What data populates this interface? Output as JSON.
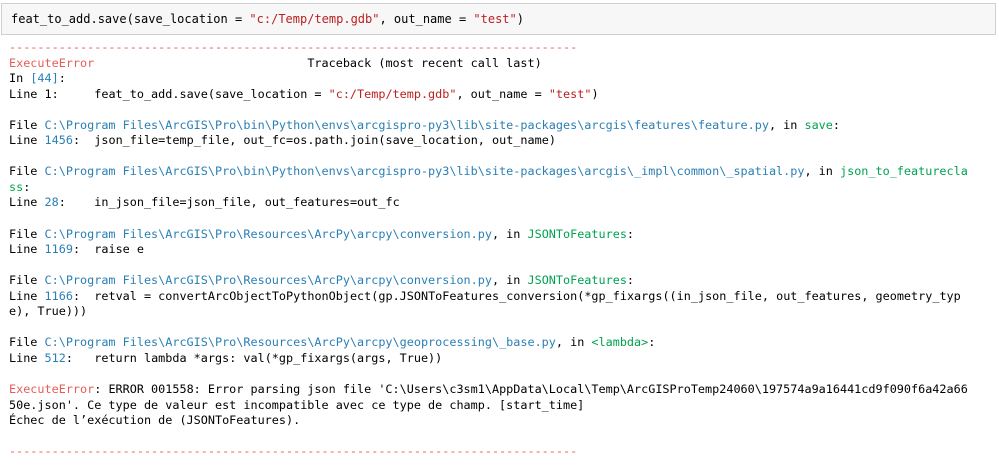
{
  "input_cell": {
    "code_prefix": "feat_to_add.save(save_location = ",
    "arg1": "\"c:/Temp/temp.gdb\"",
    "mid": ", out_name = ",
    "arg2": "\"test\"",
    "suffix": ")"
  },
  "traceback": {
    "rule": "--------------------------------------------------------------------------------",
    "error_type": "ExecuteError",
    "header_gap": "                              ",
    "header_title": "Traceback (most recent call last)",
    "in_label": "In ",
    "in_ref": "[44]",
    "in_colon": ":",
    "first_line_label": "Line 1:",
    "first_line_pad": "     ",
    "first_code_prefix": "feat_to_add.save(save_location = ",
    "first_arg1": "\"c:/Temp/temp.gdb\"",
    "first_mid": ", out_name = ",
    "first_arg2": "\"test\"",
    "first_suffix": ")",
    "frames": [
      {
        "file_label": "File ",
        "path": "C:\\Program Files\\ArcGIS\\Pro\\bin\\Python\\envs\\arcgispro-py3\\lib\\site-packages\\arcgis\\features\\feature.py",
        "in_text": ", in ",
        "func": "save",
        "func_cont": "",
        "tail": ":",
        "line_label": "Line ",
        "line_no": "1456",
        "line_colon": ":",
        "code_pad": "  ",
        "code_lines": [
          "json_file=temp_file, out_fc=os.path.join(save_location, out_name)"
        ],
        "code_cont": ""
      },
      {
        "file_label": "File ",
        "path": "C:\\Program Files\\ArcGIS\\Pro\\bin\\Python\\envs\\arcgispro-py3\\lib\\site-packages\\arcgis\\_impl\\common\\_spatial.py",
        "in_text": ", in ",
        "func": "json_to_featurecla",
        "func_cont": "ss",
        "tail": ":",
        "line_label": "Line ",
        "line_no": "28",
        "line_colon": ":",
        "code_pad": "    ",
        "code_lines": [
          "in_json_file=json_file, out_features=out_fc"
        ],
        "code_cont": ""
      },
      {
        "file_label": "File ",
        "path": "C:\\Program Files\\ArcGIS\\Pro\\Resources\\ArcPy\\arcpy\\conversion.py",
        "in_text": ", in ",
        "func": "JSONToFeatures",
        "func_cont": "",
        "tail": ":",
        "line_label": "Line ",
        "line_no": "1169",
        "line_colon": ":",
        "code_pad": "  ",
        "code_lines": [
          "raise e"
        ],
        "code_cont": ""
      },
      {
        "file_label": "File ",
        "path": "C:\\Program Files\\ArcGIS\\Pro\\Resources\\ArcPy\\arcpy\\conversion.py",
        "in_text": ", in ",
        "func": "JSONToFeatures",
        "func_cont": "",
        "tail": ":",
        "line_label": "Line ",
        "line_no": "1166",
        "line_colon": ":",
        "code_pad": "  ",
        "code_lines": [
          "retval = convertArcObjectToPythonObject(gp.JSONToFeatures_conversion(*gp_fixargs((in_json_file, out_features, geometry_typ"
        ],
        "code_cont": "e), True)))"
      },
      {
        "file_label": "File ",
        "path": "C:\\Program Files\\ArcGIS\\Pro\\Resources\\ArcPy\\arcpy\\geoprocessing\\_base.py",
        "in_text": ", in ",
        "func": "<lambda>",
        "func_cont": "",
        "tail": ":",
        "line_label": "Line ",
        "line_no": "512",
        "line_colon": ":",
        "code_pad": "   ",
        "code_lines": [
          "return lambda *args: val(*gp_fixargs(args, True))"
        ],
        "code_cont": ""
      }
    ],
    "final_error_type": "ExecuteError",
    "final_message_1": ": ERROR 001558: Error parsing json file 'C:\\Users\\c3sm1\\AppData\\Local\\Temp\\ArcGISProTemp24060\\197574a9a16441cd9f090f6a42a66",
    "final_message_2": "50e.json'. Ce type de valeur est incompatible avec ce type de champ. [start_time]",
    "final_message_3": "Échec de l’exécution de (JSONToFeatures)."
  },
  "colors": {
    "error_red": "#e75c58",
    "string_red": "#ba2121",
    "path_blue": "#2a7fb5",
    "func_green": "#00a250"
  }
}
